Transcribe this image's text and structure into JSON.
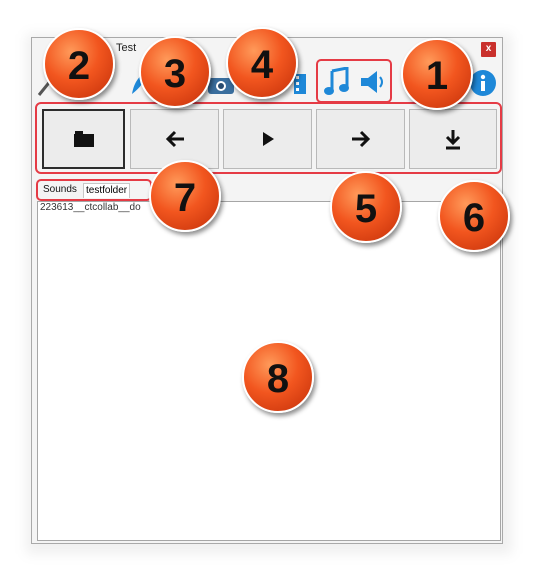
{
  "window": {
    "title": "Test",
    "close_label": "x"
  },
  "toolbar": {
    "icons": [
      "wand-icon",
      "camera-icon",
      "film-icon",
      "music-note-icon",
      "speaker-icon",
      "info-icon"
    ]
  },
  "tabs": [
    {
      "label": "Sounds",
      "active": true
    },
    {
      "label": "testfolder",
      "active": false
    }
  ],
  "list": {
    "items": [
      "223613__ctcollab__do"
    ]
  },
  "badges": [
    "1",
    "2",
    "3",
    "4",
    "5",
    "6",
    "7",
    "8"
  ],
  "colors": {
    "badge": "#f2561f",
    "highlight_outline": "#e53b45",
    "accent_icon": "#1e88d8",
    "close_button": "#c9302c"
  }
}
